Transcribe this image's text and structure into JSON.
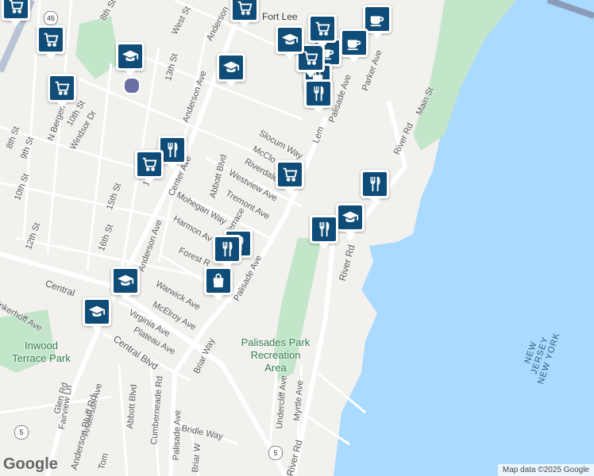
{
  "map": {
    "street_labels": [
      {
        "id": "8th-st-top",
        "text": "8th St"
      },
      {
        "id": "west-st",
        "text": "West St"
      },
      {
        "id": "anderson-top",
        "text": "Anderson"
      },
      {
        "id": "13th-st",
        "text": "13th St"
      },
      {
        "id": "anderson-ave-1",
        "text": "Anderson Ave"
      },
      {
        "id": "n-bergen",
        "text": "N Bergen"
      },
      {
        "id": "10th-st-1",
        "text": "10th St"
      },
      {
        "id": "windsor-dr",
        "text": "Windsor Dr"
      },
      {
        "id": "8th-st",
        "text": "8th St"
      },
      {
        "id": "9th-st",
        "text": "9th St"
      },
      {
        "id": "10th-st-2",
        "text": "10th St"
      },
      {
        "id": "12th-st",
        "text": "12th St"
      },
      {
        "id": "15th-st",
        "text": "15th St"
      },
      {
        "id": "16th-st",
        "text": "16th St"
      },
      {
        "id": "16-partial",
        "text": "16"
      },
      {
        "id": "center-ave",
        "text": "Center Ave"
      },
      {
        "id": "abbott-blvd-1",
        "text": "Abbott Blvd"
      },
      {
        "id": "slocum-way",
        "text": "Slocum Way"
      },
      {
        "id": "mccloud",
        "text": "McClo"
      },
      {
        "id": "riverdale",
        "text": "Riverdale"
      },
      {
        "id": "westview-ave",
        "text": "Westview Ave"
      },
      {
        "id": "tremont-ave",
        "text": "Tremont Ave"
      },
      {
        "id": "mohegan-way",
        "text": "Mohegan Way"
      },
      {
        "id": "harmon-av",
        "text": "Harmon Av"
      },
      {
        "id": "terrace",
        "text": "Terrace"
      },
      {
        "id": "anderson-ave-2",
        "text": "Anderson Ave"
      },
      {
        "id": "forest-r",
        "text": "Forest R"
      },
      {
        "id": "palisade-ave-1",
        "text": "Palisade Ave"
      },
      {
        "id": "warwick-ave",
        "text": "Warwick Ave"
      },
      {
        "id": "mcelroy-ave",
        "text": "McElroy Ave"
      },
      {
        "id": "virginia-ave",
        "text": "Virginia Ave"
      },
      {
        "id": "plateau-ave",
        "text": "Plateau Ave"
      },
      {
        "id": "central-blvd",
        "text": "Central Blvd"
      },
      {
        "id": "central-top",
        "text": "Central"
      },
      {
        "id": "brinkerhoff-ave",
        "text": "inkerhoff Ave"
      },
      {
        "id": "glen-rd",
        "text": "Glen Rd"
      },
      {
        "id": "anderson-ave-3",
        "text": "Anderson Ave"
      },
      {
        "id": "abbott-blvd-2",
        "text": "Abbott Blvd"
      },
      {
        "id": "cumberneade-rd",
        "text": "Cumberneade Rd"
      },
      {
        "id": "palisade-ave-2",
        "text": "Palisade Ave"
      },
      {
        "id": "briar-way",
        "text": "Briar Way"
      },
      {
        "id": "bridle-way",
        "text": "Bridle Way"
      },
      {
        "id": "briar-w",
        "text": "Briar W"
      },
      {
        "id": "fairview-ln",
        "text": "Fairview Ln"
      },
      {
        "id": "anderson-bluff-rd",
        "text": "Anderson Bluff Rd"
      },
      {
        "id": "tom-partial",
        "text": "Tom"
      },
      {
        "id": "undercliff-ave",
        "text": "Undercliff Ave"
      },
      {
        "id": "myrtle-ave",
        "text": "Myrtle Ave"
      },
      {
        "id": "river-rd-1",
        "text": "River Rd"
      },
      {
        "id": "river-rd-2",
        "text": "River Rd"
      },
      {
        "id": "river-rd-3",
        "text": "River Rd"
      },
      {
        "id": "main-st",
        "text": "Main St"
      },
      {
        "id": "palisade-ave-3",
        "text": "Palisade Ave"
      },
      {
        "id": "parker-ave",
        "text": "Parker Ave"
      },
      {
        "id": "lem",
        "text": "Lem"
      },
      {
        "id": "fort-lee",
        "text": "Fort Lee"
      }
    ],
    "area_labels": {
      "inwood_terrace_park": "Inwood\nTerrace Park",
      "palisades_park": "Palisades Park\nRecreation\nArea",
      "state_border": "NEW JERSEY\nNEW YORK"
    },
    "route_shields": [
      "46",
      "5",
      "5"
    ],
    "pois": [
      {
        "icon": "shopping-cart-icon"
      },
      {
        "icon": "shopping-cart-icon"
      },
      {
        "icon": "graduation-cap-icon"
      },
      {
        "icon": "shopping-cart-icon"
      },
      {
        "icon": "graduation-cap-icon"
      },
      {
        "icon": "utensils-icon"
      },
      {
        "icon": "shopping-cart-icon"
      },
      {
        "icon": "shopping-cart-icon"
      },
      {
        "icon": "utensils-icon"
      },
      {
        "icon": "graduation-cap-icon"
      },
      {
        "icon": "utensils-icon"
      },
      {
        "icon": "utensils-icon"
      },
      {
        "icon": "utensils-icon"
      },
      {
        "icon": "shopping-bag-icon"
      },
      {
        "icon": "graduation-cap-icon"
      },
      {
        "icon": "graduation-cap-icon"
      },
      {
        "icon": "shopping-cart-icon"
      },
      {
        "icon": "coffee-icon"
      },
      {
        "icon": "coffee-icon"
      },
      {
        "icon": "coffee-icon"
      },
      {
        "icon": "shopping-bag-icon"
      },
      {
        "icon": "shopping-cart-icon"
      },
      {
        "icon": "utensils-icon"
      },
      {
        "icon": "graduation-cap-icon"
      },
      {
        "icon": "shopping-cart-icon"
      }
    ],
    "attribution": "Map data ©2025 Google",
    "logo": "Google"
  },
  "colors": {
    "land": "#f2f1ee",
    "water": "#aadaff",
    "park": "#c3e6cb",
    "road": "#ffffff",
    "highway": "#b9c3d6",
    "poi_blue": "#0f4d78"
  }
}
